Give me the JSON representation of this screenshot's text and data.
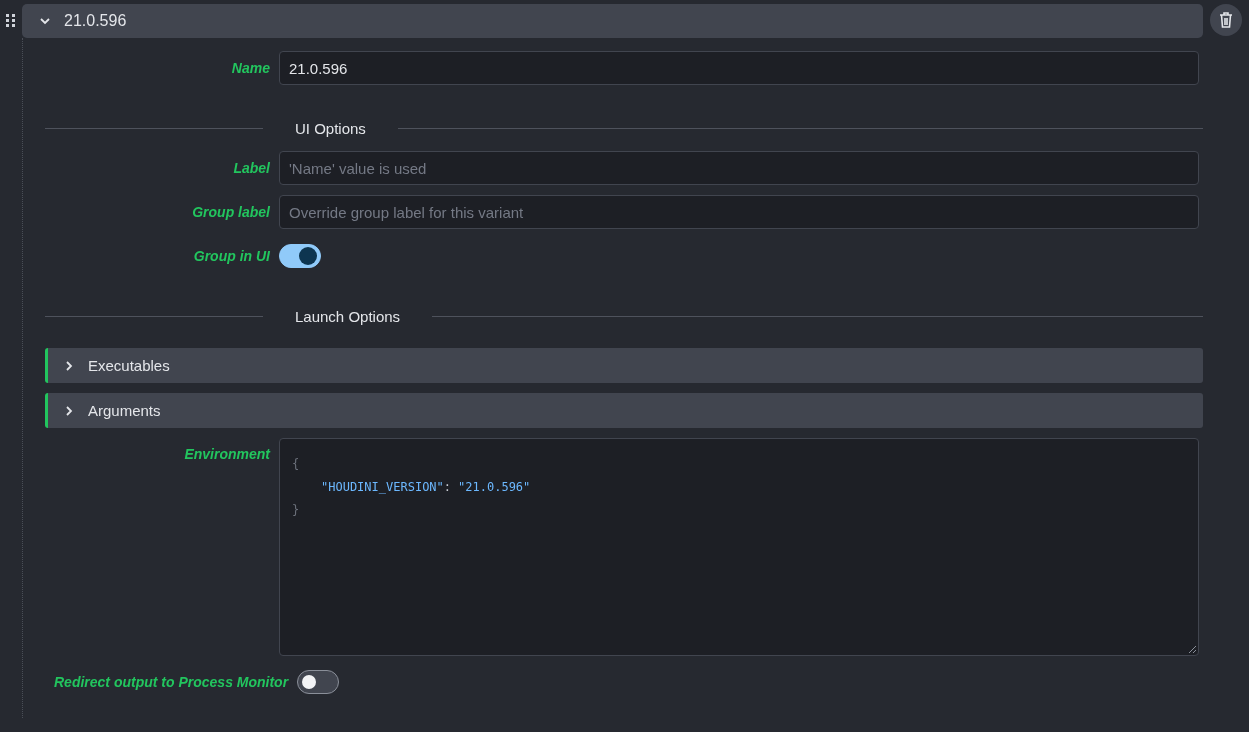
{
  "header": {
    "title": "21.0.596",
    "expanded": true
  },
  "items": [
    {
      "kind": "text",
      "label": "Name",
      "value": "21.0.596"
    },
    {
      "kind": "divider",
      "label": "UI Options"
    },
    {
      "kind": "text",
      "label": "Label",
      "placeholder": "'Name' value is used"
    },
    {
      "kind": "text",
      "label": "Group label",
      "placeholder": "Override group label for this variant"
    },
    {
      "kind": "toggle",
      "label": "Group in UI",
      "on": true
    },
    {
      "kind": "divider",
      "label": "Launch Options"
    },
    {
      "kind": "collapsible",
      "label": "Executables",
      "expanded": false
    },
    {
      "kind": "collapsible",
      "label": "Arguments",
      "expanded": false
    },
    {
      "kind": "code",
      "label": "Environment",
      "lines": [
        {
          "kind": "brace",
          "text": "{"
        },
        {
          "kind": "entry",
          "key": "\"HOUDINI_VERSION\"",
          "separator": ":",
          "value": "\"21.0.596\""
        },
        {
          "kind": "brace",
          "text": "}"
        }
      ]
    },
    {
      "kind": "inline-toggle",
      "label": "Redirect output to Process Monitor",
      "on": false
    }
  ]
}
